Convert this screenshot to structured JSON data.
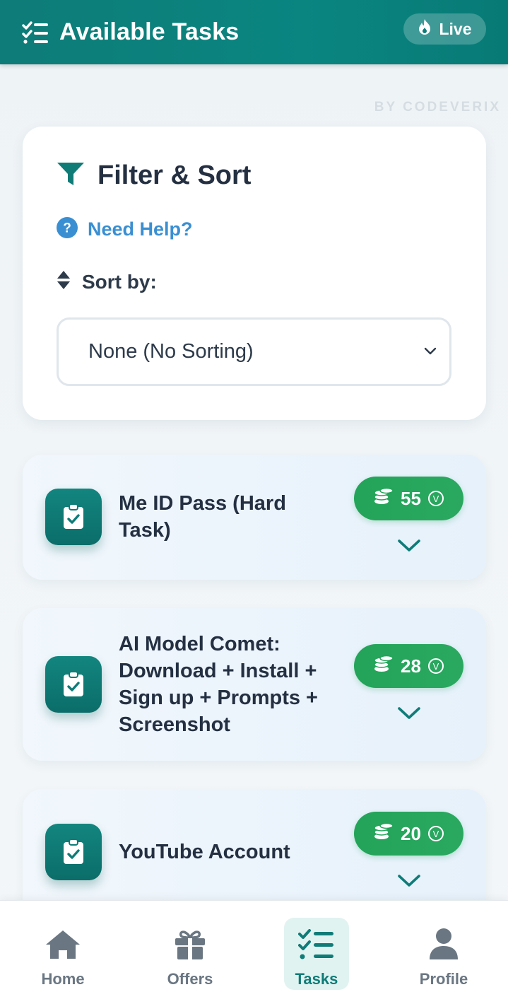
{
  "header": {
    "title": "Available Tasks",
    "live_label": "Live"
  },
  "brand": "BY CODEVERIX",
  "filter": {
    "title": "Filter & Sort",
    "help_label": "Need Help?",
    "sort_label": "Sort by:",
    "sort_value": "None (No Sorting)"
  },
  "tasks": [
    {
      "title": "Me ID Pass (Hard Task)",
      "reward": "55",
      "currency_symbol": "V"
    },
    {
      "title": "AI Model Comet: Download + Install + Sign up + Prompts + Screenshot",
      "reward": "28",
      "currency_symbol": "V"
    },
    {
      "title": "YouTube Account",
      "reward": "20",
      "currency_symbol": "V"
    }
  ],
  "nav": [
    {
      "label": "Home",
      "icon": "home-icon"
    },
    {
      "label": "Offers",
      "icon": "gift-icon"
    },
    {
      "label": "Tasks",
      "icon": "tasks-icon",
      "active": true
    },
    {
      "label": "Profile",
      "icon": "user-icon"
    }
  ],
  "colors": {
    "header": "#0e7c78",
    "accent": "#0f7c78",
    "reward": "#23a459",
    "help": "#3a8fd2",
    "title": "#243042"
  }
}
